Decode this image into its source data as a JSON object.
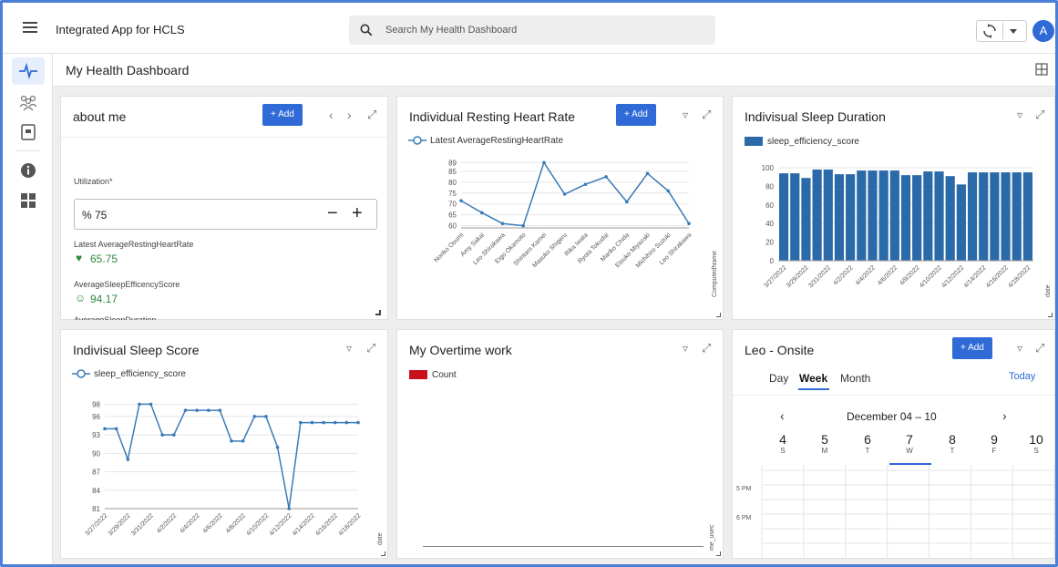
{
  "app": {
    "title": "Integrated App for HCLS",
    "avatar_letter": "A"
  },
  "search": {
    "placeholder": "Search My Health Dashboard"
  },
  "page": {
    "title": "My Health Dashboard"
  },
  "rail": {
    "icons": [
      "heartbeat-icon",
      "people-icon",
      "document-icon",
      "info-icon",
      "dashboard-grid-icon"
    ]
  },
  "about": {
    "title": "about me",
    "add_label": "+ Add",
    "utilization_label": "Utilization*",
    "utilization_value": "% 75",
    "hr_label": "Latest AverageRestingHeartRate",
    "hr_value": "65.75",
    "sleep_label": "AverageSleepEfficencyScore",
    "sleep_value": "94.17",
    "cut_label": "AverageSleepDuration"
  },
  "hr_card": {
    "title": "Individual Resting Heart Rate",
    "add_label": "+ Add",
    "legend": "Latest AverageRestingHeartRate",
    "y_axis_right": "ComputedName"
  },
  "sleep_dur": {
    "title": "Indivisual Sleep Duration",
    "legend": "sleep_efficiency_score",
    "y_axis_right": "date"
  },
  "sleep_score": {
    "title": "Indivisual Sleep Score",
    "legend": "sleep_efficiency_score",
    "y_axis_right": "date"
  },
  "overtime": {
    "title": "My Overtime work",
    "legend": "Count",
    "y_axis_right": "me_usec"
  },
  "calendar": {
    "title": "Leo - Onsite",
    "add_label": "+ Add",
    "tabs": [
      "Day",
      "Week",
      "Month"
    ],
    "today": "Today",
    "range": "December 04 – 10",
    "days": [
      {
        "n": "4",
        "d": "S"
      },
      {
        "n": "5",
        "d": "M"
      },
      {
        "n": "6",
        "d": "T"
      },
      {
        "n": "7",
        "d": "W"
      },
      {
        "n": "8",
        "d": "T"
      },
      {
        "n": "9",
        "d": "F"
      },
      {
        "n": "10",
        "d": "S"
      }
    ],
    "times": [
      "5 PM",
      "6 PM"
    ]
  },
  "chart_data": [
    {
      "type": "line",
      "title": "Individual Resting Heart Rate",
      "series": [
        {
          "name": "Latest AverageRestingHeartRate",
          "values": [
            71.5,
            66,
            61,
            60,
            89,
            74.5,
            79,
            82.5,
            71,
            84,
            76,
            61
          ]
        }
      ],
      "categories": [
        "Noriko Osumi",
        "Amy Sakai",
        "Leo Shirakawa",
        "Eigo Okamoto",
        "Shintaro Kamei",
        "Masuko Shigeru",
        "Rika Iwata",
        "Ryota Tokudai",
        "Mariko Chida",
        "Etsuko Miyazaki",
        "Michihiro Suzuki",
        "Leo Shirakawa"
      ],
      "yticks": [
        60,
        65,
        70,
        75,
        80,
        85,
        89
      ],
      "ylim": [
        59,
        90
      ],
      "grid": true
    },
    {
      "type": "bar",
      "title": "Indivisual Sleep Duration",
      "series": [
        {
          "name": "sleep_efficiency_score",
          "values": [
            94,
            94,
            89,
            98,
            98,
            93,
            93,
            97,
            97,
            97,
            97,
            92,
            92,
            96,
            96,
            91,
            82,
            95,
            95,
            95,
            95,
            95,
            95
          ]
        }
      ],
      "xticks": [
        "3/27/2022",
        "3/29/2022",
        "3/31/2022",
        "4/2/2022",
        "4/4/2022",
        "4/6/2022",
        "4/8/2022",
        "4/10/2022",
        "4/12/2022",
        "4/14/2022",
        "4/16/2022",
        "4/18/2022"
      ],
      "yticks": [
        0,
        20,
        40,
        60,
        80,
        100
      ],
      "ylim": [
        0,
        100
      ],
      "grid": true
    },
    {
      "type": "line",
      "title": "Indivisual Sleep Score",
      "series": [
        {
          "name": "sleep_efficiency_score",
          "values": [
            94,
            94,
            89,
            98,
            98,
            93,
            93,
            97,
            97,
            97,
            97,
            92,
            92,
            96,
            96,
            91,
            81,
            95,
            95,
            95,
            95,
            95,
            95
          ]
        }
      ],
      "xticks": [
        "3/27/2022",
        "3/29/2022",
        "3/31/2022",
        "4/2/2022",
        "4/4/2022",
        "4/6/2022",
        "4/8/2022",
        "4/10/2022",
        "4/12/2022",
        "4/14/2022",
        "4/16/2022",
        "4/18/2022"
      ],
      "yticks": [
        81,
        84,
        87,
        90,
        93,
        96,
        98
      ],
      "ylim": [
        81,
        98.5
      ],
      "grid": true
    }
  ]
}
